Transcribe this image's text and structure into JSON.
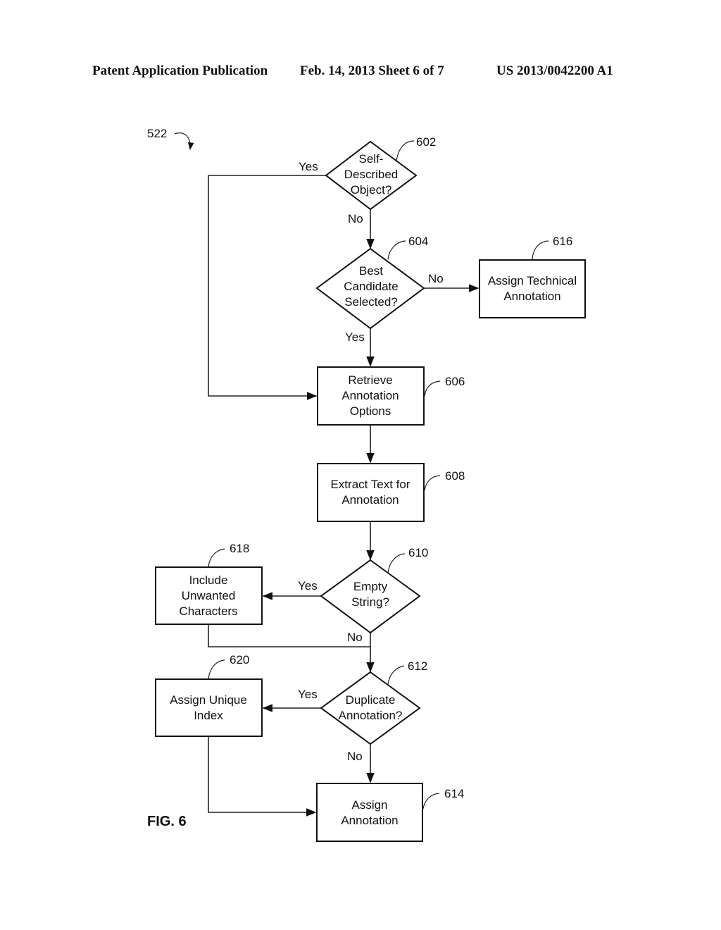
{
  "header": {
    "left": "Patent Application Publication",
    "middle": "Feb. 14, 2013   Sheet 6 of 7",
    "right": "US 2013/0042200 A1"
  },
  "figure": {
    "label": "FIG. 6",
    "ref": "522"
  },
  "nodes": {
    "n602": {
      "ref": "602",
      "type": "decision",
      "lines": [
        "Self-",
        "Described",
        "Object?"
      ]
    },
    "n604": {
      "ref": "604",
      "type": "decision",
      "lines": [
        "Best",
        "Candidate",
        "Selected?"
      ]
    },
    "n606": {
      "ref": "606",
      "type": "process",
      "lines": [
        "Retrieve",
        "Annotation",
        "Options"
      ]
    },
    "n608": {
      "ref": "608",
      "type": "process",
      "lines": [
        "Extract Text for",
        "Annotation"
      ]
    },
    "n610": {
      "ref": "610",
      "type": "decision",
      "lines": [
        "Empty",
        "String?"
      ]
    },
    "n612": {
      "ref": "612",
      "type": "decision",
      "lines": [
        "Duplicate",
        "Annotation?"
      ]
    },
    "n614": {
      "ref": "614",
      "type": "process",
      "lines": [
        "Assign",
        "Annotation"
      ]
    },
    "n616": {
      "ref": "616",
      "type": "process",
      "lines": [
        "Assign Technical",
        "Annotation"
      ]
    },
    "n618": {
      "ref": "618",
      "type": "process",
      "lines": [
        "Include",
        "Unwanted",
        "Characters"
      ]
    },
    "n620": {
      "ref": "620",
      "type": "process",
      "lines": [
        "Assign Unique",
        "Index"
      ]
    }
  },
  "edge_labels": {
    "e602_yes": "Yes",
    "e602_no": "No",
    "e604_no": "No",
    "e604_yes": "Yes",
    "e610_yes": "Yes",
    "e610_no": "No",
    "e612_yes": "Yes",
    "e612_no": "No"
  }
}
